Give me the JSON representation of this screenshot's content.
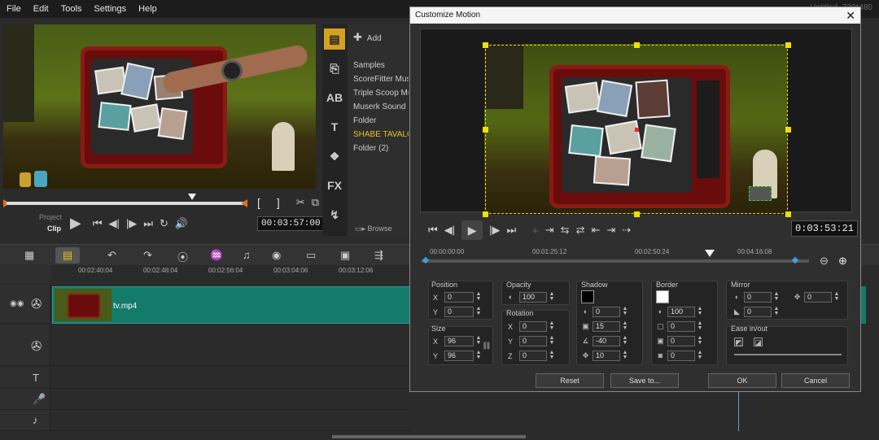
{
  "menu": {
    "file": "File",
    "edit": "Edit",
    "tools": "Tools",
    "settings": "Settings",
    "help": "Help"
  },
  "window_title": "Untitled, 720*480",
  "player": {
    "project_label": "Project",
    "clip_label": "Clip",
    "timecode": "00:03:57:00",
    "bracket_in": "[",
    "bracket_out": "]"
  },
  "library": {
    "add_label": "Add",
    "browse_label": "Browse",
    "items": [
      "Samples",
      "ScoreFitter Music",
      "Triple Scoop Music",
      "Muserk Sound Effects",
      "Folder",
      "SHABE TAVALOD",
      "Folder (2)"
    ],
    "selected_color": "#e8c21a"
  },
  "timeline": {
    "ruler": [
      "00:02:40:04",
      "00:02:48:04",
      "00:02:56:04",
      "00:03:04:06",
      "00:03:12:06"
    ],
    "clip_name": "tv.mp4",
    "clip_color": "#147a6a"
  },
  "dialog": {
    "title": "Customize Motion",
    "close": "✕",
    "timecode": "0:03:53:21",
    "ruler": [
      "00:00:00:00",
      "00:01:25:12",
      "00:02:50:24",
      "00:04:16:08"
    ],
    "position": {
      "label": "Position",
      "x": "0",
      "y": "0"
    },
    "size": {
      "label": "Size",
      "x": "96",
      "y": "96"
    },
    "opacity": {
      "label": "Opacity",
      "value": "100"
    },
    "rotation": {
      "label": "Rotation",
      "x": "0",
      "y": "0",
      "z": "0"
    },
    "shadow": {
      "label": "Shadow",
      "v1": "0",
      "v2": "15",
      "v3": "-40",
      "v4": "10",
      "color": "#000000"
    },
    "border": {
      "label": "Border",
      "v1": "100",
      "v2": "0",
      "v3": "0",
      "v4": "0",
      "color": "#ffffff"
    },
    "mirror": {
      "label": "Mirror",
      "v1": "0",
      "v2": "0",
      "v3": "0"
    },
    "ease": {
      "label": "Ease in/out"
    },
    "x_label": "X",
    "y_label": "Y",
    "z_label": "Z",
    "buttons": {
      "reset": "Reset",
      "save": "Save to...",
      "ok": "OK",
      "cancel": "Cancel"
    }
  }
}
